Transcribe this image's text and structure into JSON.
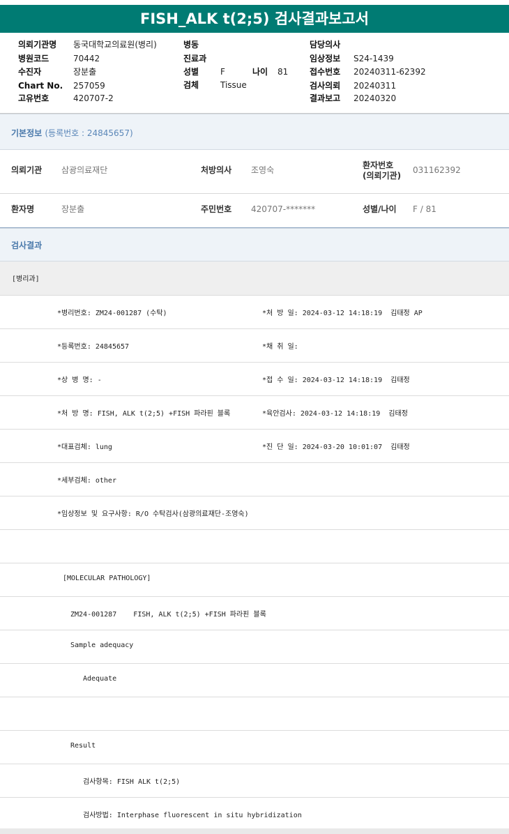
{
  "report": {
    "title": "FISH_ALK t(2;5) 검사결과보고서"
  },
  "header": {
    "requesting_institution_label": "의뢰기관명",
    "requesting_institution": "동국대학교의료원(병리)",
    "hospital_code_label": "병원코드",
    "hospital_code": "70442",
    "examinee_label": "수진자",
    "examinee": "장분출",
    "chart_no_label": "Chart No.",
    "chart_no": "257059",
    "unique_no_label": "고유번호",
    "unique_no": "420707-2",
    "ward_label": "병동",
    "ward": "",
    "department_label": "진료과",
    "department": "",
    "sex_label": "성별",
    "sex": "F",
    "age_label": "나이",
    "age": "81",
    "specimen_label": "검체",
    "specimen": "Tissue",
    "attending_label": "담당의사",
    "attending": "",
    "clinical_info_label": "임상정보",
    "clinical_info": "S24-1439",
    "receipt_no_label": "접수번호",
    "receipt_no": "20240311-62392",
    "request_date_label": "검사의뢰",
    "request_date": "20240311",
    "report_date_label": "결과보고",
    "report_date": "20240320"
  },
  "basic_info": {
    "title": "기본정보",
    "registration": "(등록번호 : 24845657)",
    "institution_label": "의뢰기관",
    "institution": "삼광의료재단",
    "prescriber_label": "처방의사",
    "prescriber": "조영숙",
    "patient_no_label_1": "환자번호",
    "patient_no_label_2": "(의뢰기관)",
    "patient_no": "031162392",
    "patient_name_label": "환자명",
    "patient_name": "장분출",
    "resident_no_label": "주민번호",
    "resident_no": "420707-*******",
    "sex_age_label": "성별/나이",
    "sex_age": "F / 81"
  },
  "results": {
    "title": "검사결과",
    "dept": "[병리과]",
    "rows": [
      {
        "left": "*병리번호: ZM24-001287 (수탁)",
        "right": "*처 방 일: 2024-03-12 14:18:19  김태정 AP"
      },
      {
        "left": "*등록번호: 24845657",
        "right": "*채 취 일:"
      },
      {
        "left": "*상 병 명: -",
        "right": "*접 수 일: 2024-03-12 14:18:19  김태정"
      },
      {
        "left": "*처 방 명: FISH, ALK t(2;5) +FISH 파라핀 블록",
        "right": "*육안검사: 2024-03-12 14:18:19  김태정"
      },
      {
        "left": "*대표검체: lung",
        "right": "*진 단 일: 2024-03-20 10:01:07  김태정"
      },
      {
        "left": "*세부검체: other",
        "right": ""
      },
      {
        "left": "*임상정보 및 요구사항: R/O 수탁검사(삼광의료재단-조영숙)",
        "right": ""
      }
    ],
    "molecular_header": "[MOLECULAR PATHOLOGY]",
    "case_line": "ZM24-001287    FISH, ALK t(2;5) +FISH 파라핀 블록",
    "sample_adequacy": "Sample adequacy",
    "adequate": "Adequate",
    "result_label": "Result",
    "test_item": "검사항목: FISH ALK t(2;5)",
    "test_method": "검사방법: Interphase fluorescent in situ hybridization"
  }
}
